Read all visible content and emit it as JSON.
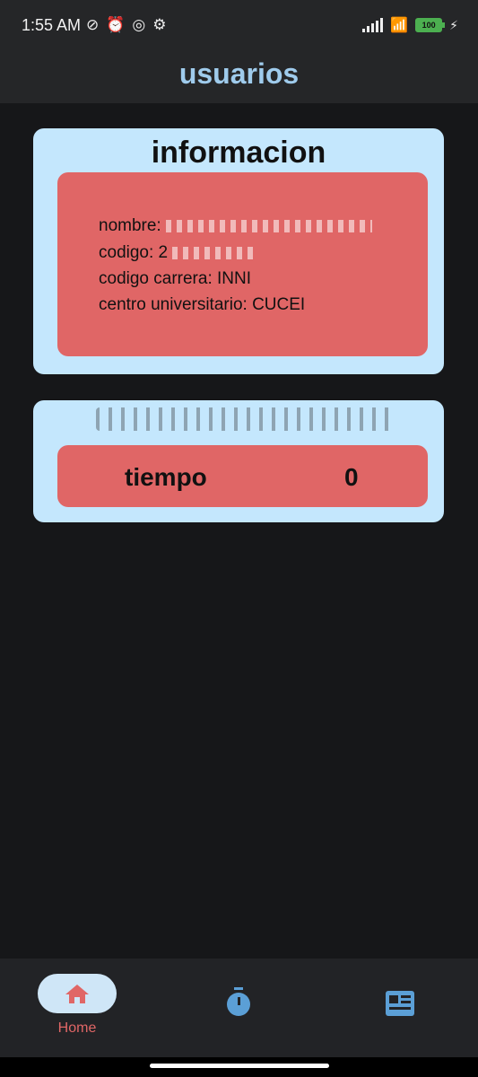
{
  "status_bar": {
    "time": "1:55 AM",
    "battery": "100"
  },
  "app_bar": {
    "title": "usuarios"
  },
  "info_card": {
    "title": "informacion",
    "lines": {
      "nombre": "nombre:",
      "codigo": "codigo: 2",
      "carrera": "codigo carrera: INNI",
      "centro": "centro universitario: CUCEI"
    }
  },
  "timer_card": {
    "label": "tiempo",
    "value": "0"
  },
  "bottom_nav": {
    "items": [
      {
        "label": "Home",
        "icon": "home-icon",
        "selected": true
      },
      {
        "label": "",
        "icon": "stopwatch-icon",
        "selected": false
      },
      {
        "label": "",
        "icon": "article-icon",
        "selected": false
      }
    ]
  },
  "colors": {
    "background": "#161719",
    "bar": "#252628",
    "card": "#c4e7fd",
    "accent_box": "#e06666",
    "title": "#9fcbec",
    "nav_icon": "#5b9fd6"
  }
}
